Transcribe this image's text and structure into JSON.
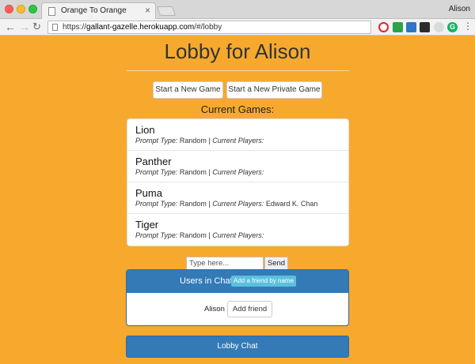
{
  "browser": {
    "tab_title": "Orange To Orange",
    "tab_close": "×",
    "user_name": "Alison",
    "url_prefix": "https://",
    "url_host": "gallant-gazelle.herokuapp.com",
    "url_path": "/#/lobby",
    "back_icon": "←",
    "forward_icon": "→",
    "reload_icon": "↻",
    "extensions": [
      "opera-icon",
      "beta-icon",
      "cast-icon",
      "code-icon",
      "extension-icon",
      "grammarly-icon",
      "menu-icon"
    ],
    "ext_g_label": "G",
    "menu_glyph": "⋮"
  },
  "page": {
    "title": "Lobby for Alison",
    "start_game_label": "Start a New Game",
    "start_private_label": "Start a New Private Game",
    "current_games_label": "Current Games:"
  },
  "games": [
    {
      "name": "Lion",
      "prompt_type_label": "Prompt Type:",
      "prompt_type": "Random",
      "separator": "|",
      "players_label": "Current Players:",
      "players": ""
    },
    {
      "name": "Panther",
      "prompt_type_label": "Prompt Type:",
      "prompt_type": "Random",
      "separator": "|",
      "players_label": "Current Players:",
      "players": ""
    },
    {
      "name": "Puma",
      "prompt_type_label": "Prompt Type:",
      "prompt_type": "Random",
      "separator": "|",
      "players_label": "Current Players:",
      "players": "Edward K. Chan"
    },
    {
      "name": "Tiger",
      "prompt_type_label": "Prompt Type:",
      "prompt_type": "Random",
      "separator": "|",
      "players_label": "Current Players:",
      "players": ""
    }
  ],
  "chat": {
    "input_placeholder": "Type here...",
    "input_value": "",
    "send_label": "Send"
  },
  "users_panel": {
    "title": "Users in Chat",
    "add_by_name_label": "Add a friend by name",
    "users": [
      {
        "name": "Alison",
        "add_label": "Add friend"
      }
    ]
  },
  "lobby_chat": {
    "label": "Lobby Chat"
  },
  "colors": {
    "background": "#f7a92d",
    "primary": "#337ab7",
    "info": "#5bc0de"
  }
}
